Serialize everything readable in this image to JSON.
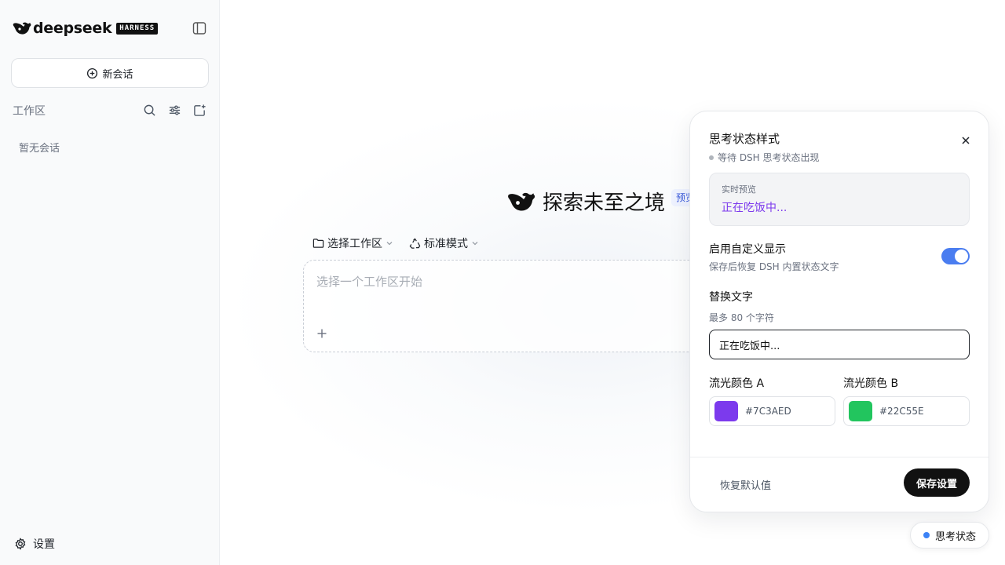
{
  "sidebar": {
    "brand": "deepseek",
    "brand_badge": "HARNESS",
    "new_chat_label": "新会话",
    "workspace_label": "工作区",
    "empty_text": "暂无会话",
    "settings_label": "设置"
  },
  "main": {
    "hero_title": "探索未至之境",
    "badge_text": "预览",
    "workspace_select": "选择工作区",
    "mode_select": "标准模式",
    "input_placeholder": "选择一个工作区开始"
  },
  "panel": {
    "title": "思考状态样式",
    "status_text": "等待 DSH 思考状态出现",
    "preview_label": "实时预览",
    "preview_value": "正在吃饭中...",
    "toggle_title": "启用自定义显示",
    "toggle_sub": "保存后恢复 DSH 内置状态文字",
    "toggle_on": true,
    "replace_title": "替换文字",
    "replace_sub": "最多 80 个字符",
    "replace_value": "正在吃饭中...",
    "color_a_label": "流光颜色 A",
    "color_a": "#7C3AED",
    "color_b_label": "流光颜色 B",
    "color_b": "#22C55E",
    "reset_label": "恢复默认值",
    "save_label": "保存设置"
  },
  "thinking_pill_label": "思考状态",
  "colors": {
    "accent_blue": "#4a7df0",
    "preview_purple": "#7c3aed"
  }
}
